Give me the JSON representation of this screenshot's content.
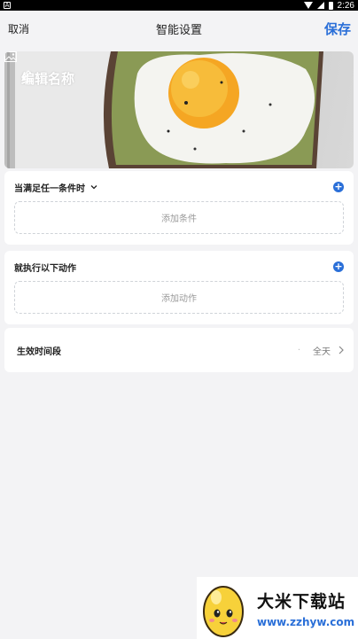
{
  "status_bar": {
    "time": "2:26",
    "left_icon": "notification-icon",
    "icons": [
      "wifi-icon",
      "signal-icon",
      "battery-icon"
    ]
  },
  "header": {
    "cancel_label": "取消",
    "title": "智能设置",
    "save_label": "保存",
    "accent_color": "#2a6fd8"
  },
  "hero": {
    "name_label": "编辑名称",
    "edit_icon": "pencil-icon",
    "image_icon": "image-icon"
  },
  "condition": {
    "title": "当满足任一条件时",
    "dropdown_icon": "chevron-down-icon",
    "add_icon": "plus-circle-icon",
    "placeholder": "添加条件"
  },
  "action": {
    "title": "就执行以下动作",
    "add_icon": "plus-circle-icon",
    "placeholder": "添加动作"
  },
  "time_period": {
    "label": "生效时间段",
    "dot": "·",
    "value": "全天",
    "chevron_icon": "chevron-right-icon"
  },
  "watermark": {
    "title": "大米下载站",
    "url": "www.zzhyw.com"
  }
}
